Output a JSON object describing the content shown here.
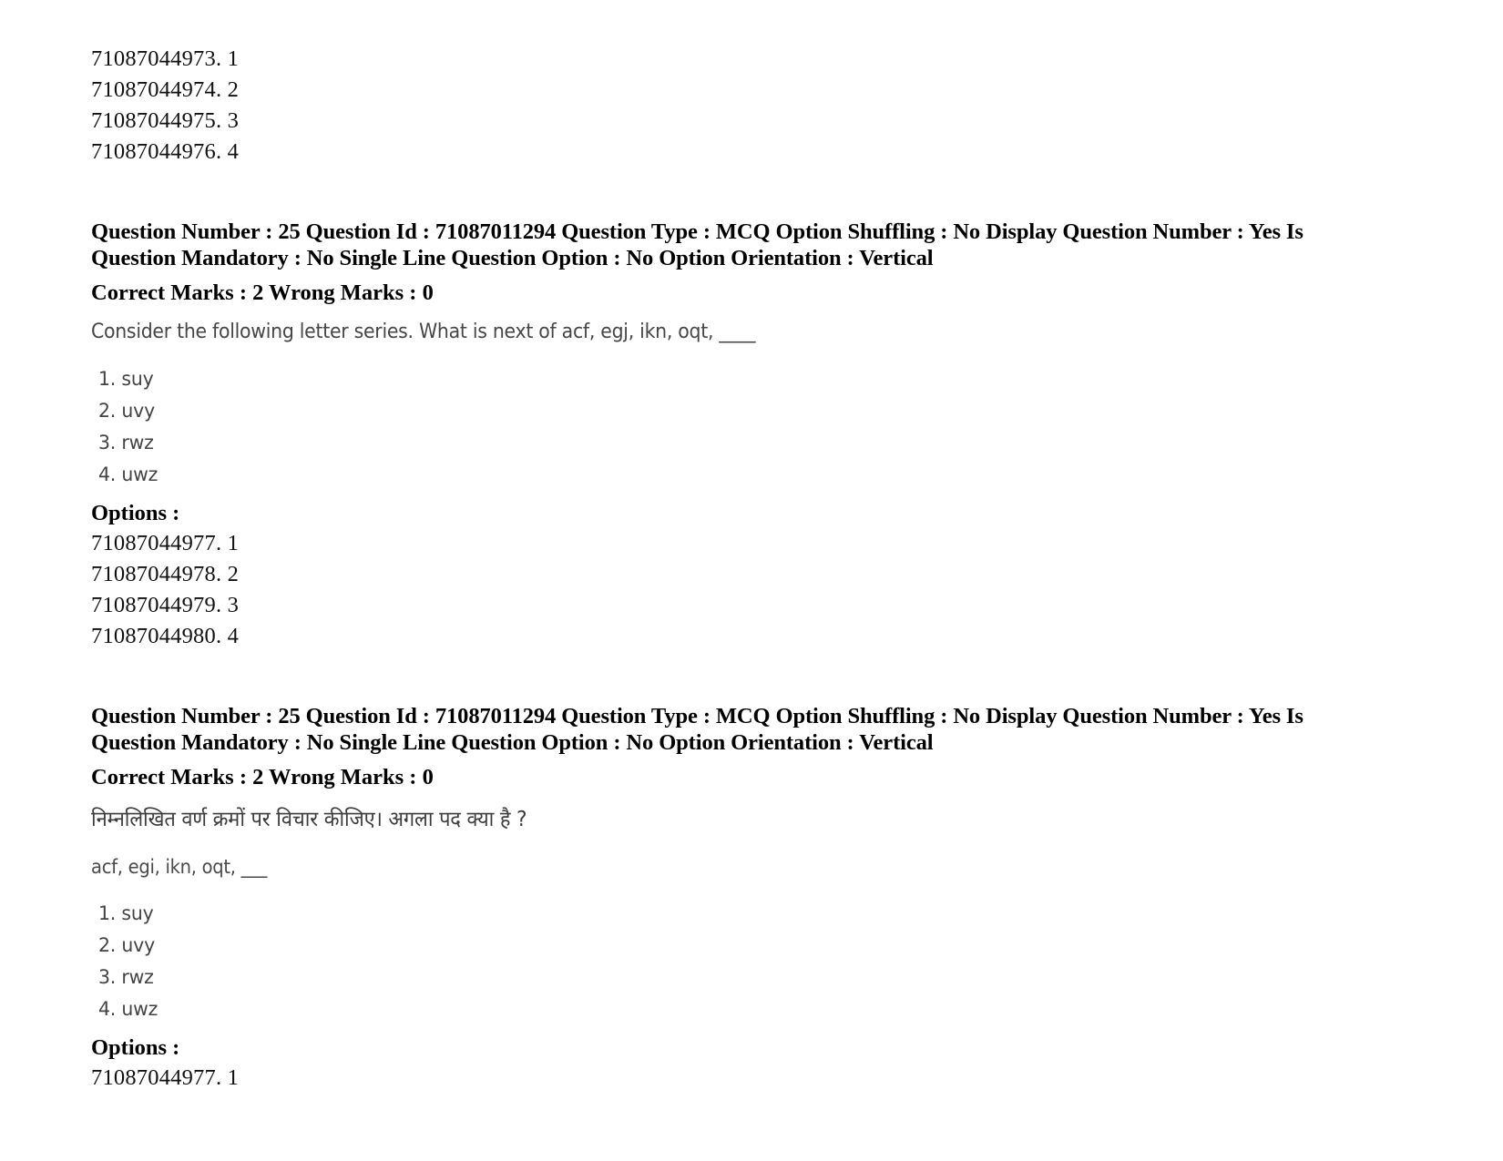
{
  "document": {
    "top_option_ids": [
      "71087044973. 1",
      "71087044974. 2",
      "71087044975. 3",
      "71087044976. 4"
    ],
    "blocks": [
      {
        "meta_line1": "Question Number : 25 Question Id : 71087011294 Question Type : MCQ Option Shuffling : No Display Question Number : Yes Is",
        "meta_line2": "Question Mandatory : No Single Line Question Option : No Option Orientation : Vertical",
        "marks_line": "Correct Marks : 2 Wrong Marks : 0",
        "question_text": "Consider the following letter series. What is next of acf, egj, ikn, oqt, ____",
        "question_text_hi": "",
        "series_line": "",
        "choices": [
          "1. suy",
          "2. uvy",
          "3. rwz",
          "4. uwz"
        ],
        "options_label": "Options :",
        "option_ids": [
          "71087044977. 1",
          "71087044978. 2",
          "71087044979. 3",
          "71087044980. 4"
        ]
      },
      {
        "meta_line1": "Question Number : 25 Question Id : 71087011294 Question Type : MCQ Option Shuffling : No Display Question Number : Yes Is",
        "meta_line2": "Question Mandatory : No Single Line Question Option : No Option Orientation : Vertical",
        "marks_line": "Correct Marks : 2 Wrong Marks : 0",
        "question_text": "",
        "question_text_hi": "निम्नलिखित वर्ण क्रमों पर विचार कीजिए। अगला पद क्या है ?",
        "series_line": "acf, egi, ikn, oqt, ___",
        "choices": [
          "1. suy",
          "2. uvy",
          "3. rwz",
          "4. uwz"
        ],
        "options_label": "Options :",
        "option_ids": [
          "71087044977. 1"
        ]
      }
    ]
  }
}
